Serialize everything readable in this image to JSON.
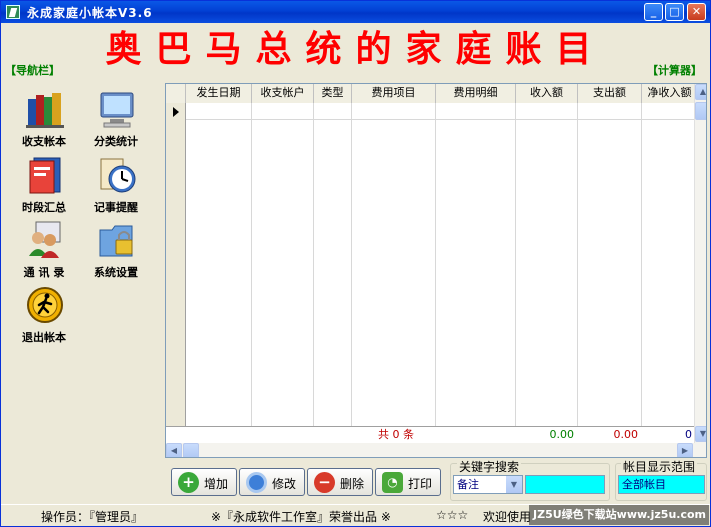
{
  "window": {
    "title": "永成家庭小帐本V3.6",
    "minimize_glyph": "_",
    "maximize_glyph": "□",
    "close_glyph": "✕"
  },
  "banner": {
    "text": "奥巴马总统的家庭账目"
  },
  "nav": {
    "label": "【导航栏】",
    "items": [
      {
        "label": "收支帐本",
        "icon": "books-icon"
      },
      {
        "label": "分类统计",
        "icon": "computer-icon"
      },
      {
        "label": "时段汇总",
        "icon": "notebook-icon"
      },
      {
        "label": "记事提醒",
        "icon": "clock-icon"
      },
      {
        "label": "通 讯 录",
        "icon": "contacts-icon"
      },
      {
        "label": "系统设置",
        "icon": "lock-folder-icon"
      },
      {
        "label": "退出帐本",
        "icon": "exit-icon"
      }
    ]
  },
  "calculator": {
    "label": "【计算器】"
  },
  "grid": {
    "columns": [
      "发生日期",
      "收支帐户",
      "类型",
      "费用项目",
      "费用明细",
      "收入额",
      "支出额",
      "净收入额"
    ],
    "rows": [],
    "footer": {
      "count_text": "共 0 条",
      "income_total": "0.00",
      "expense_total": "0.00",
      "net_total": "0"
    },
    "scroll_up": "▲",
    "scroll_down": "▼",
    "scroll_left": "◀",
    "scroll_right": "▶"
  },
  "toolbar": {
    "add_label": "增加",
    "edit_label": "修改",
    "delete_label": "删除",
    "print_label": "打印"
  },
  "search": {
    "legend": "关键字搜索",
    "field_value": "备注",
    "dropdown_glyph": "▼",
    "keyword_value": ""
  },
  "range": {
    "legend": "帐目显示范围",
    "value": "全部帐目"
  },
  "status": {
    "operator": "操作员：『管理员』",
    "credit": "※『永成软件工作室』荣誉出品 ※",
    "stars": "☆☆☆",
    "welcome": "欢迎使用"
  },
  "watermark": {
    "text": "JZ5U绿色下载站www.jz5u.com"
  },
  "colors": {
    "banner": "#ff0000",
    "nav_label": "#008000",
    "income": "#008000",
    "expense": "#c00000",
    "search_highlight": "#00ffff"
  }
}
